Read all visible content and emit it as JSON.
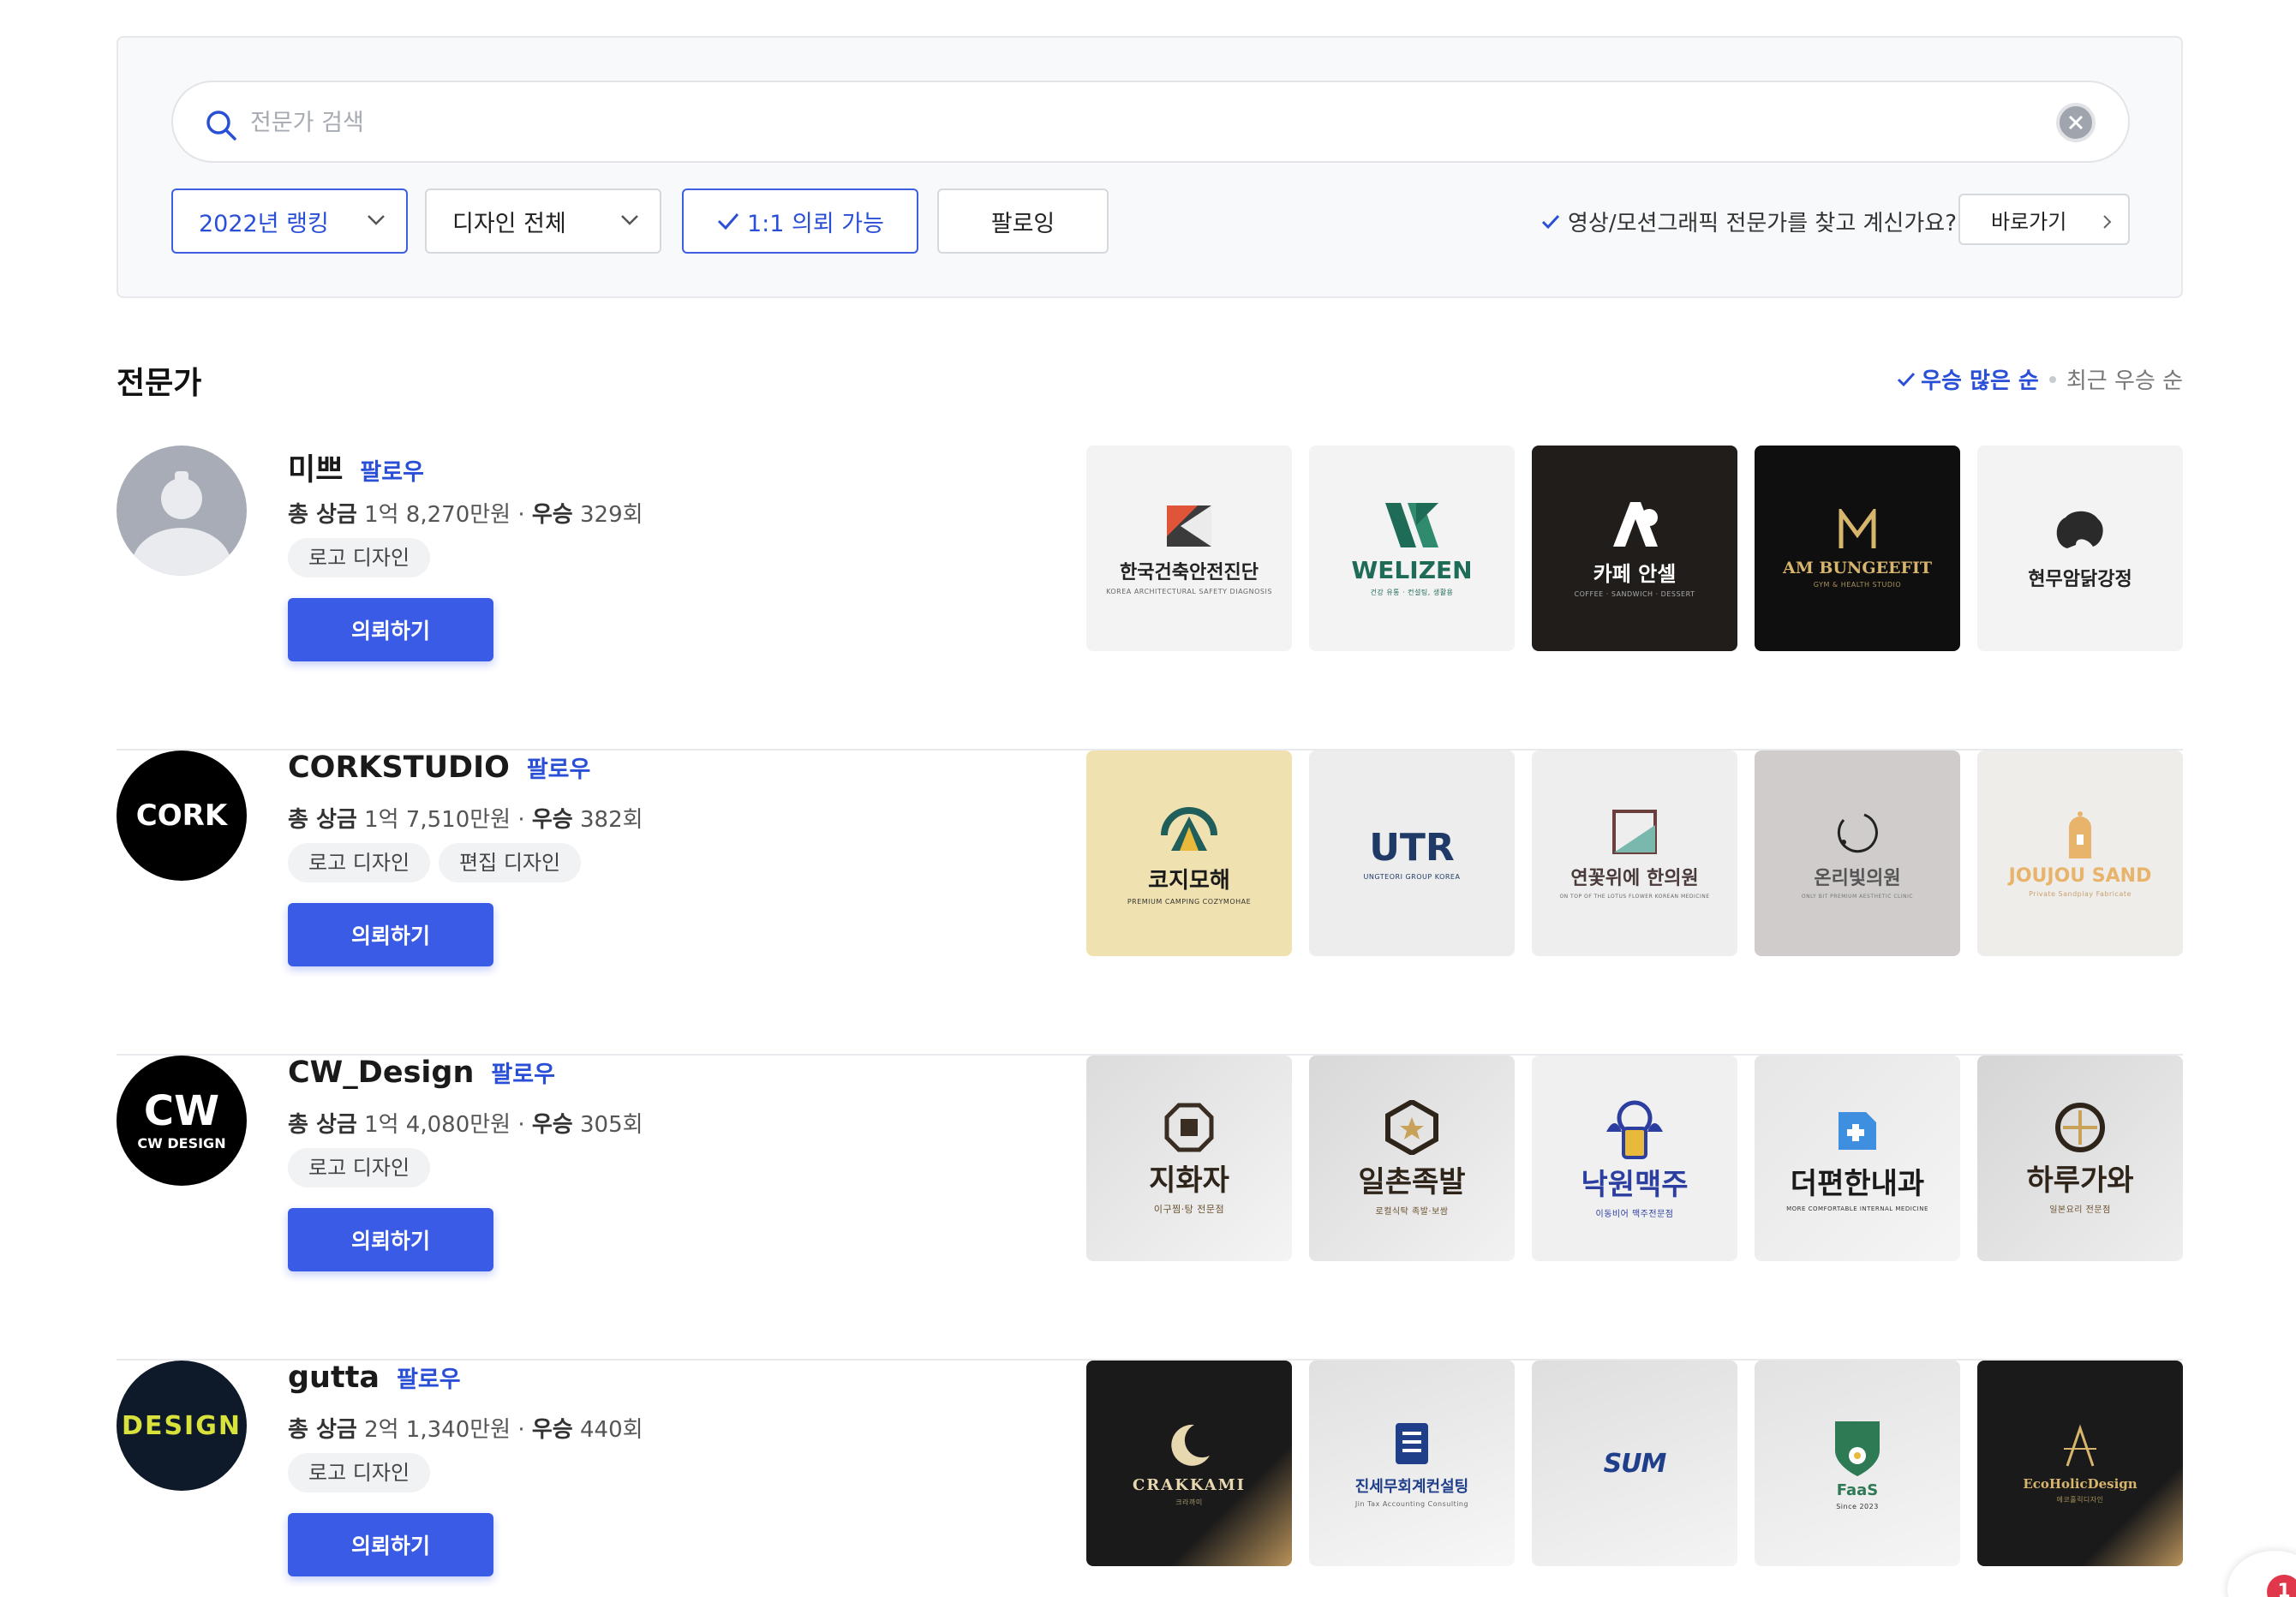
{
  "search": {
    "placeholder": "전문가 검색"
  },
  "filters": {
    "ranking": "2022년 랭킹",
    "category": "디자인 전체",
    "one_to_one": "1:1 의뢰 가능",
    "following": "팔로잉"
  },
  "video_question": "영상/모션그래픽 전문가를 찾고 계신가요?",
  "goto_label": "바로가기",
  "section_title": "전문가",
  "sort": {
    "active": "우승 많은 순",
    "inactive": "최근 우승 순"
  },
  "colors": {
    "accent": "#2a4fd7",
    "button": "#3a5be6"
  },
  "experts": [
    {
      "name": "미쁘",
      "follow": "팔로우",
      "prize_label": "총 상금",
      "prize": "1억 8,270만원",
      "wins_label": "우승",
      "wins": "329회",
      "tags": [
        "로고 디자인"
      ],
      "request": "의뢰하기",
      "avatar": "default-user-icon",
      "works": [
        {
          "text": "한국건축안전진단",
          "sub": "KOREA ARCHITECTURAL SAFETY DIAGNOSIS"
        },
        {
          "text": "WELIZEN",
          "sub": "건강 유통 · 컨설팅, 생활용"
        },
        {
          "text": "카페 안셀",
          "sub": "COFFEE · SANDWICH · DESSERT"
        },
        {
          "text": "AM BUNGEEFIT",
          "sub": "GYM & HEALTH STUDIO"
        },
        {
          "text": "현무암닭강정",
          "sub": ""
        }
      ]
    },
    {
      "name": "CORKSTUDIO",
      "follow": "팔로우",
      "prize_label": "총 상금",
      "prize": "1억 7,510만원",
      "wins_label": "우승",
      "wins": "382회",
      "tags": [
        "로고 디자인",
        "편집 디자인"
      ],
      "request": "의뢰하기",
      "avatar": "CORK",
      "works": [
        {
          "text": "코지모해",
          "sub": "PREMIUM CAMPING COZYMOHAE"
        },
        {
          "text": "UTR",
          "sub": "UNGTEORI GROUP KOREA"
        },
        {
          "text": "연꽃위에 한의원",
          "sub": "ON TOP OF THE LOTUS FLOWER KOREAN MEDICINE"
        },
        {
          "text": "온리빛의원",
          "sub": "ONLY BIT PREMIUM AESTHETIC CLINIC"
        },
        {
          "text": "JOUJOU SAND",
          "sub": "Private Sandplay Fabricate"
        }
      ]
    },
    {
      "name": "CW_Design",
      "follow": "팔로우",
      "prize_label": "총 상금",
      "prize": "1억 4,080만원",
      "wins_label": "우승",
      "wins": "305회",
      "tags": [
        "로고 디자인"
      ],
      "request": "의뢰하기",
      "avatar": "CW",
      "avatar_sub": "CW DESIGN",
      "works": [
        {
          "text": "지화자",
          "sub": "이구찜·탕 전문점"
        },
        {
          "text": "일촌족발",
          "sub": "로컬식탁 족발·보쌈"
        },
        {
          "text": "낙원맥주",
          "sub": "이동비어 맥주전문점"
        },
        {
          "text": "더편한내과",
          "sub": "MORE COMFORTABLE INTERNAL MEDICINE"
        },
        {
          "text": "하루가와",
          "sub": "일본요리 전문점"
        }
      ]
    },
    {
      "name": "gutta",
      "follow": "팔로우",
      "prize_label": "총 상금",
      "prize": "2억 1,340만원",
      "wins_label": "우승",
      "wins": "440회",
      "tags": [
        "로고 디자인"
      ],
      "request": "의뢰하기",
      "avatar": "DESIGN",
      "works": [
        {
          "text": "CRAKKAMI",
          "sub": "크라까미"
        },
        {
          "text": "진세무회계컨설팅",
          "sub": "Jin Tax Accounting Consulting"
        },
        {
          "text": "SUM",
          "sub": ""
        },
        {
          "text": "FaaS",
          "sub": "Since 2023"
        },
        {
          "text": "EcoHolicDesign",
          "sub": "에코홀릭디자인"
        }
      ]
    }
  ],
  "notification_count": "1"
}
